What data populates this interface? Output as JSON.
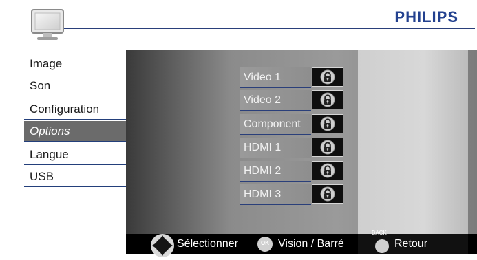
{
  "brand": {
    "logo_text": "PHILIPS",
    "color": "#23418f"
  },
  "sidebar": {
    "items": [
      {
        "label": "Image",
        "active": false
      },
      {
        "label": "Son",
        "active": false
      },
      {
        "label": "Configuration",
        "active": false
      },
      {
        "label": "Options",
        "active": true
      },
      {
        "label": "Langue",
        "active": false
      },
      {
        "label": "USB",
        "active": false
      }
    ]
  },
  "inputs": {
    "items": [
      {
        "label": "Video 1",
        "icon": "lock-icon"
      },
      {
        "label": "Video 2",
        "icon": "lock-icon"
      },
      {
        "label": "Component",
        "icon": "lock-icon"
      },
      {
        "label": "HDMI 1",
        "icon": "lock-icon"
      },
      {
        "label": "HDMI 2",
        "icon": "lock-icon"
      },
      {
        "label": "HDMI 3",
        "icon": "lock-icon"
      }
    ]
  },
  "footer": {
    "select_label": "Sélectionner",
    "ok_badge": "OK",
    "ok_label": "Vision / Barré",
    "back_badge": "BACK",
    "back_label": "Retour"
  }
}
